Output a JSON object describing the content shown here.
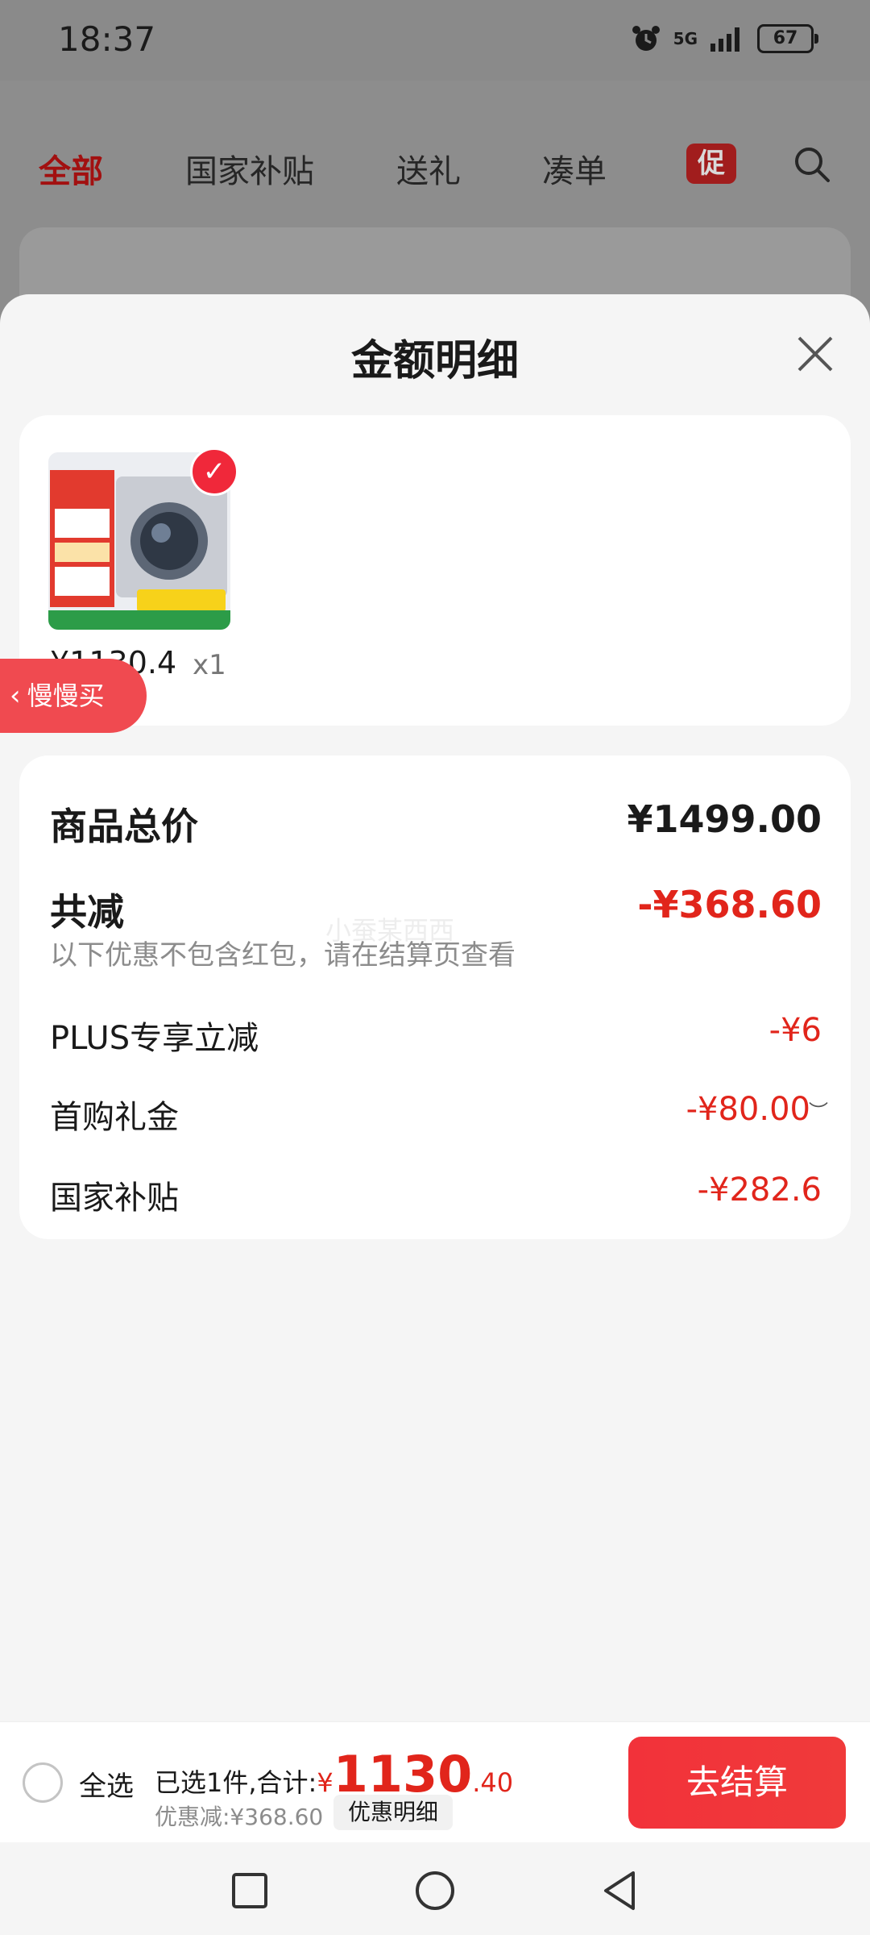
{
  "status_bar": {
    "time": "18:37",
    "network": "5G",
    "battery": "67"
  },
  "background_page": {
    "tabs": [
      "全部",
      "国家补贴",
      "送礼",
      "凑单"
    ],
    "promo_tag": "促"
  },
  "sheet": {
    "title": "金额明细",
    "product": {
      "price": "¥1130.4",
      "quantity": "x1",
      "image": "washing-machine-product-image"
    },
    "side_tag": "慢慢买",
    "details": {
      "total_label": "商品总价",
      "total_value": "¥1499.00",
      "discount_label": "共减",
      "discount_value": "-¥368.60",
      "discount_note": "以下优惠不包含红包，请在结算页查看",
      "watermark": "小蚕某西西",
      "items": [
        {
          "label": "PLUS专享立减",
          "value": "-¥6"
        },
        {
          "label": "首购礼金",
          "value": "-¥80.00"
        },
        {
          "label": "国家补贴",
          "value": "-¥282.6"
        }
      ]
    }
  },
  "checkout": {
    "select_all": "全选",
    "selected_prefix": "已选1件,合计:",
    "currency": "¥",
    "total_int": "1130",
    "total_dec": ".40",
    "saved": "优惠减:¥368.60",
    "detail_button": "优惠明细",
    "checkout_button": "去结算"
  },
  "colors": {
    "accent": "#e1251b",
    "checkout_button": "#f2323a",
    "sheet_bg": "#f5f5f5"
  }
}
